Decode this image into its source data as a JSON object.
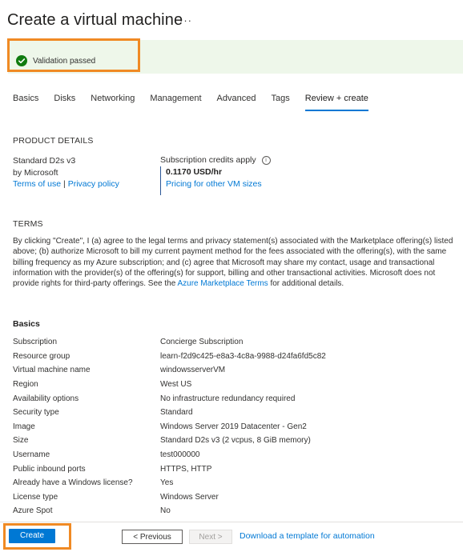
{
  "page": {
    "title": "Create a virtual machine",
    "more": "···"
  },
  "colors": {
    "accent": "#0078d4",
    "success": "#107c10",
    "highlight": "#f08a24"
  },
  "validation": {
    "icon": "check-circle-icon",
    "text": "Validation passed"
  },
  "tabs": [
    {
      "label": "Basics"
    },
    {
      "label": "Disks"
    },
    {
      "label": "Networking"
    },
    {
      "label": "Management"
    },
    {
      "label": "Advanced"
    },
    {
      "label": "Tags"
    },
    {
      "label": "Review + create",
      "active": true
    }
  ],
  "product": {
    "heading": "PRODUCT DETAILS",
    "name": "Standard D2s v3",
    "publisher": "by Microsoft",
    "terms_link": "Terms of use",
    "separator": "|",
    "privacy_link": "Privacy policy",
    "credits_label": "Subscription credits apply",
    "price": "0.1170 USD/hr",
    "pricing_link": "Pricing for other VM sizes"
  },
  "terms": {
    "heading": "TERMS",
    "text_before": "By clicking \"Create\", I (a) agree to the legal terms and privacy statement(s) associated with the Marketplace offering(s) listed above; (b) authorize Microsoft to bill my current payment method for the fees associated with the offering(s), with the same billing frequency as my Azure subscription; and (c) agree that Microsoft may share my contact, usage and transactional information with the provider(s) of the offering(s) for support, billing and other transactional activities. Microsoft does not provide rights for third-party offerings. See the ",
    "link": "Azure Marketplace Terms",
    "text_after": " for additional details."
  },
  "basics": {
    "heading": "Basics",
    "rows": [
      {
        "key": "Subscription",
        "value": "Concierge Subscription"
      },
      {
        "key": "Resource group",
        "value": "learn-f2d9c425-e8a3-4c8a-9988-d24fa6fd5c82"
      },
      {
        "key": "Virtual machine name",
        "value": "windowsserverVM"
      },
      {
        "key": "Region",
        "value": "West US"
      },
      {
        "key": "Availability options",
        "value": "No infrastructure redundancy required"
      },
      {
        "key": "Security type",
        "value": "Standard"
      },
      {
        "key": "Image",
        "value": "Windows Server 2019 Datacenter - Gen2"
      },
      {
        "key": "Size",
        "value": "Standard D2s v3 (2 vcpus, 8 GiB memory)"
      },
      {
        "key": "Username",
        "value": "test000000"
      },
      {
        "key": "Public inbound ports",
        "value": "HTTPS, HTTP"
      },
      {
        "key": "Already have a Windows license?",
        "value": "Yes"
      },
      {
        "key": "License type",
        "value": "Windows Server"
      },
      {
        "key": "Azure Spot",
        "value": "No"
      }
    ]
  },
  "footer": {
    "create_label": "Create",
    "previous_label": "< Previous",
    "next_label": "Next >",
    "download_link": "Download a template for automation"
  }
}
